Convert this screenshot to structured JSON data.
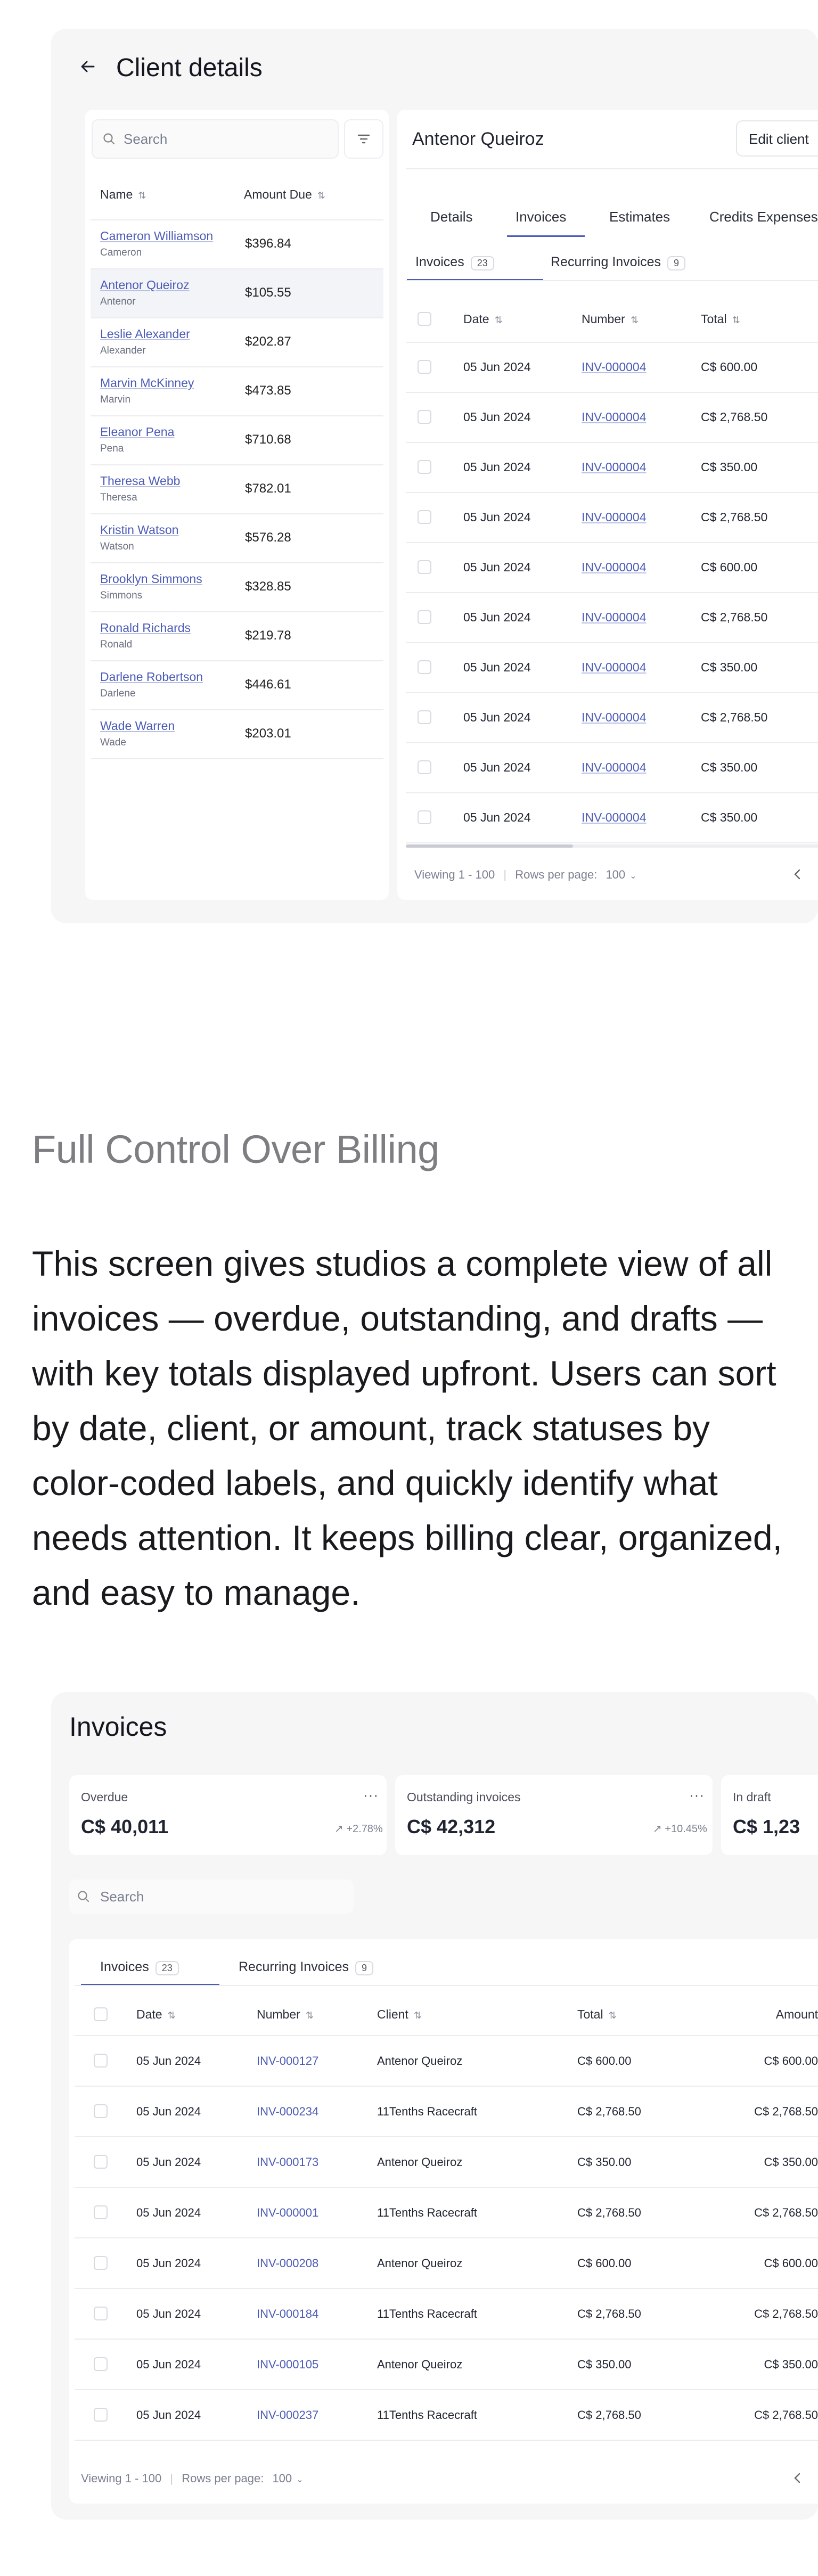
{
  "client_details": {
    "title": "Client details",
    "search_placeholder": "Search",
    "columns": {
      "name": "Name",
      "amount": "Amount Due"
    },
    "clients": [
      {
        "name": "Cameron Williamson",
        "sub": "Cameron",
        "amount": "$396.84"
      },
      {
        "name": "Antenor Queiroz",
        "sub": "Antenor",
        "amount": "$105.55"
      },
      {
        "name": "Leslie Alexander",
        "sub": "Alexander",
        "amount": "$202.87"
      },
      {
        "name": "Marvin McKinney",
        "sub": "Marvin",
        "amount": "$473.85"
      },
      {
        "name": "Eleanor Pena",
        "sub": "Pena",
        "amount": "$710.68"
      },
      {
        "name": "Theresa Webb",
        "sub": "Theresa",
        "amount": "$782.01"
      },
      {
        "name": "Kristin Watson",
        "sub": "Watson",
        "amount": "$576.28"
      },
      {
        "name": "Brooklyn Simmons",
        "sub": "Simmons",
        "amount": "$328.85"
      },
      {
        "name": "Ronald Richards",
        "sub": "Ronald",
        "amount": "$219.78"
      },
      {
        "name": "Darlene Robertson",
        "sub": "Darlene",
        "amount": "$446.61"
      },
      {
        "name": "Wade Warren",
        "sub": "Wade",
        "amount": "$203.01"
      }
    ],
    "detail": {
      "client_name": "Antenor Queiroz",
      "edit_button": "Edit client",
      "tabs": [
        "Details",
        "Invoices",
        "Estimates",
        "Credits Expenses"
      ],
      "subtabs": [
        {
          "label": "Invoices",
          "count": "23"
        },
        {
          "label": "Recurring Invoices",
          "count": "9"
        }
      ],
      "columns": {
        "date": "Date",
        "number": "Number",
        "total": "Total"
      },
      "rows": [
        {
          "date": "05 Jun 2024",
          "number": "INV-000004",
          "total": "C$ 600.00"
        },
        {
          "date": "05 Jun 2024",
          "number": "INV-000004",
          "total": "C$ 2,768.50"
        },
        {
          "date": "05 Jun 2024",
          "number": "INV-000004",
          "total": "C$ 350.00"
        },
        {
          "date": "05 Jun 2024",
          "number": "INV-000004",
          "total": "C$ 2,768.50"
        },
        {
          "date": "05 Jun 2024",
          "number": "INV-000004",
          "total": "C$ 600.00"
        },
        {
          "date": "05 Jun 2024",
          "number": "INV-000004",
          "total": "C$ 2,768.50"
        },
        {
          "date": "05 Jun 2024",
          "number": "INV-000004",
          "total": "C$ 350.00"
        },
        {
          "date": "05 Jun 2024",
          "number": "INV-000004",
          "total": "C$ 2,768.50"
        },
        {
          "date": "05 Jun 2024",
          "number": "INV-000004",
          "total": "C$ 350.00"
        },
        {
          "date": "05 Jun 2024",
          "number": "INV-000004",
          "total": "C$ 350.00"
        }
      ],
      "footer": {
        "viewing": "Viewing 1 - 100",
        "rows_per_page": "Rows per page:",
        "rows_value": "100"
      }
    }
  },
  "section": {
    "heading": "Full Control Over Billing",
    "body": "This screen gives studios a complete view of all invoices — overdue, outstanding, and drafts — with key totals displayed upfront. Users can sort by date, client, or amount, track statuses by color-coded labels, and quickly identify what needs attention. It keeps billing clear, organized, and easy to manage."
  },
  "invoices_page": {
    "title": "Invoices",
    "stats": [
      {
        "label": "Overdue",
        "value": "C$ 40,011",
        "trend": "+2.78%"
      },
      {
        "label": "Outstanding invoices",
        "value": "C$ 42,312",
        "trend": "+10.45%"
      },
      {
        "label": "In draft",
        "value": "C$ 1,23"
      }
    ],
    "search_placeholder": "Search",
    "subtabs": [
      {
        "label": "Invoices",
        "count": "23"
      },
      {
        "label": "Recurring Invoices",
        "count": "9"
      }
    ],
    "columns": {
      "date": "Date",
      "number": "Number",
      "client": "Client",
      "total": "Total",
      "amount": "Amount"
    },
    "rows": [
      {
        "date": "05 Jun 2024",
        "number": "INV-000127",
        "client": "Antenor Queiroz",
        "total": "C$ 600.00",
        "amount": "C$ 600.00"
      },
      {
        "date": "05 Jun 2024",
        "number": "INV-000234",
        "client": "11Tenths Racecraft",
        "total": "C$ 2,768.50",
        "amount": "C$ 2,768.50"
      },
      {
        "date": "05 Jun 2024",
        "number": "INV-000173",
        "client": "Antenor Queiroz",
        "total": "C$ 350.00",
        "amount": "C$ 350.00"
      },
      {
        "date": "05 Jun 2024",
        "number": "INV-000001",
        "client": "11Tenths Racecraft",
        "total": "C$ 2,768.50",
        "amount": "C$ 2,768.50"
      },
      {
        "date": "05 Jun 2024",
        "number": "INV-000208",
        "client": "Antenor Queiroz",
        "total": "C$ 600.00",
        "amount": "C$ 600.00"
      },
      {
        "date": "05 Jun 2024",
        "number": "INV-000184",
        "client": "11Tenths Racecraft",
        "total": "C$ 2,768.50",
        "amount": "C$ 2,768.50"
      },
      {
        "date": "05 Jun 2024",
        "number": "INV-000105",
        "client": "Antenor Queiroz",
        "total": "C$ 350.00",
        "amount": "C$ 350.00"
      },
      {
        "date": "05 Jun 2024",
        "number": "INV-000237",
        "client": "11Tenths Racecraft",
        "total": "C$ 2,768.50",
        "amount": "C$ 2,768.50"
      }
    ],
    "footer": {
      "viewing": "Viewing 1 - 100",
      "rows_per_page": "Rows per page:",
      "rows_value": "100"
    }
  }
}
